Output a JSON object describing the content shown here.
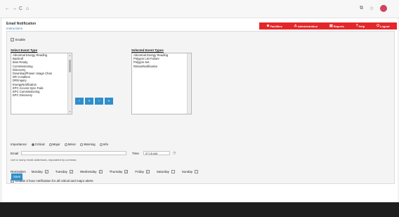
{
  "browser": {
    "nav_back": "←",
    "nav_forward": "→",
    "nav_reload": "C",
    "nav_home": "⌂",
    "icons": [
      "extensions-icon",
      "star-icon",
      "profile-avatar"
    ]
  },
  "topnav": {
    "items": [
      {
        "icon": "⊕",
        "label": "Facilities"
      },
      {
        "icon": "⚠",
        "label": "Administration"
      },
      {
        "icon": "▤",
        "label": "Reports"
      },
      {
        "icon": "?",
        "label": "Help"
      },
      {
        "icon": "⏻",
        "label": "Logout"
      }
    ]
  },
  "header": {
    "title": "Email Notification",
    "subtitle": "Instructions"
  },
  "form": {
    "enable_label": "Enable",
    "enable_checked": true,
    "select_event_label": "Select Event Type",
    "available_events": [
      "Abnormal Energy Reading",
      "Backroll",
      "Bios Ready",
      "Commissioning",
      "Discovery",
      "Download/Power Usage Chan",
      "DR Condition",
      "DR/Inquiry",
      "EnergyNotification",
      "EPC Access Sync Fails",
      "EPC Commissioning",
      "EPC Discovery"
    ],
    "selected_event_label": "Selected Event Types",
    "selected_events": [
      "Abnormal Energy Reading",
      "Polygon List Failure",
      "Polygon Set",
      "RebootNotification"
    ],
    "move_buttons": [
      "›",
      "»",
      "‹",
      "«"
    ],
    "importance_label": "Importance:",
    "importance_options": [
      "Critical",
      "Major",
      "Minor",
      "Warning",
      "Info"
    ],
    "importance_selected": "Critical",
    "email_label": "Email",
    "email_value": "",
    "time_label": "Time",
    "time_value": "07:15 AM",
    "help_text": "List to many email addresses, separated by commas",
    "reminders_label": "Reminders",
    "days": [
      {
        "label": "Monday",
        "checked": true
      },
      {
        "label": "Tuesday",
        "checked": true
      },
      {
        "label": "Wednesday",
        "checked": true
      },
      {
        "label": "Thursday",
        "checked": true
      },
      {
        "label": "Friday",
        "checked": true
      },
      {
        "label": "Saturday",
        "checked": false
      },
      {
        "label": "Sunday",
        "checked": false
      }
    ],
    "report_label": "Enable 3 hour notification for all critical and major alerts",
    "report_checked": true,
    "save_label": "Save"
  },
  "colors": {
    "accent": "#e4262a",
    "button": "#2f8fca"
  }
}
